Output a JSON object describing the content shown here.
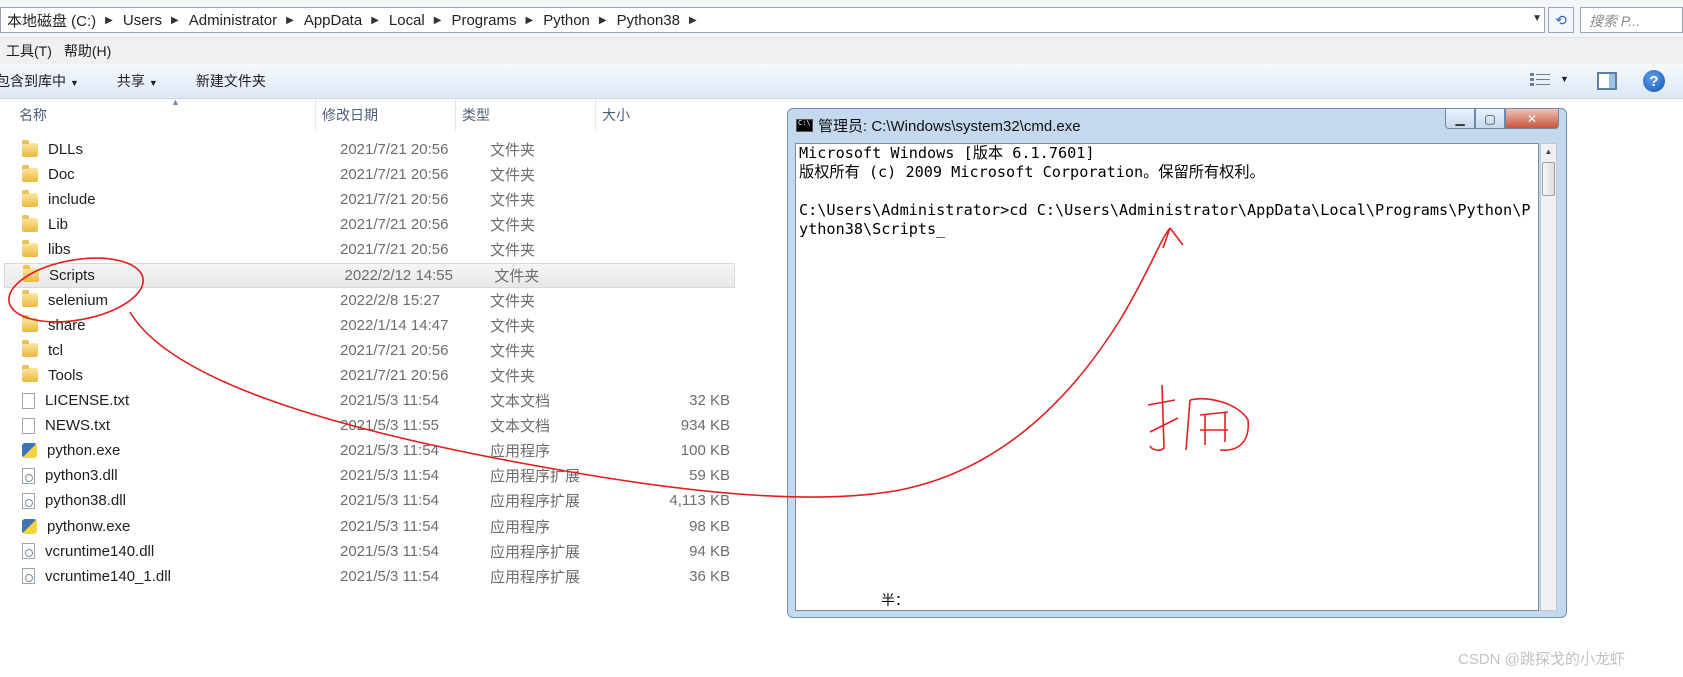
{
  "address": {
    "crumbs": [
      "本地磁盘 (C:)",
      "Users",
      "Administrator",
      "AppData",
      "Local",
      "Programs",
      "Python",
      "Python38"
    ],
    "search_placeholder": "搜索 P..."
  },
  "menu": {
    "items": [
      "工具(T)",
      "帮助(H)"
    ]
  },
  "toolbar": {
    "include_library": "包含到库中",
    "share": "共享",
    "new_folder": "新建文件夹"
  },
  "columns": {
    "name": "名称",
    "modified": "修改日期",
    "type": "类型",
    "size": "大小"
  },
  "files": [
    {
      "name": "DLLs",
      "date": "2021/7/21 20:56",
      "type": "文件夹",
      "size": "",
      "icon": "folder-icon"
    },
    {
      "name": "Doc",
      "date": "2021/7/21 20:56",
      "type": "文件夹",
      "size": "",
      "icon": "folder-icon"
    },
    {
      "name": "include",
      "date": "2021/7/21 20:56",
      "type": "文件夹",
      "size": "",
      "icon": "folder-icon"
    },
    {
      "name": "Lib",
      "date": "2021/7/21 20:56",
      "type": "文件夹",
      "size": "",
      "icon": "folder-icon"
    },
    {
      "name": "libs",
      "date": "2021/7/21 20:56",
      "type": "文件夹",
      "size": "",
      "icon": "folder-icon"
    },
    {
      "name": "Scripts",
      "date": "2022/2/12 14:55",
      "type": "文件夹",
      "size": "",
      "icon": "folder-icon",
      "selected": true
    },
    {
      "name": "selenium",
      "date": "2022/2/8 15:27",
      "type": "文件夹",
      "size": "",
      "icon": "folder-icon"
    },
    {
      "name": "share",
      "date": "2022/1/14 14:47",
      "type": "文件夹",
      "size": "",
      "icon": "folder-icon"
    },
    {
      "name": "tcl",
      "date": "2021/7/21 20:56",
      "type": "文件夹",
      "size": "",
      "icon": "folder-icon"
    },
    {
      "name": "Tools",
      "date": "2021/7/21 20:56",
      "type": "文件夹",
      "size": "",
      "icon": "folder-icon"
    },
    {
      "name": "LICENSE.txt",
      "date": "2021/5/3 11:54",
      "type": "文本文档",
      "size": "32 KB",
      "icon": "text-file-icon"
    },
    {
      "name": "NEWS.txt",
      "date": "2021/5/3 11:55",
      "type": "文本文档",
      "size": "934 KB",
      "icon": "text-file-icon"
    },
    {
      "name": "python.exe",
      "date": "2021/5/3 11:54",
      "type": "应用程序",
      "size": "100 KB",
      "icon": "python-exe-icon"
    },
    {
      "name": "python3.dll",
      "date": "2021/5/3 11:54",
      "type": "应用程序扩展",
      "size": "59 KB",
      "icon": "dll-file-icon"
    },
    {
      "name": "python38.dll",
      "date": "2021/5/3 11:54",
      "type": "应用程序扩展",
      "size": "4,113 KB",
      "icon": "dll-file-icon"
    },
    {
      "name": "pythonw.exe",
      "date": "2021/5/3 11:54",
      "type": "应用程序",
      "size": "98 KB",
      "icon": "python-exe-icon"
    },
    {
      "name": "vcruntime140.dll",
      "date": "2021/5/3 11:54",
      "type": "应用程序扩展",
      "size": "94 KB",
      "icon": "dll-file-icon"
    },
    {
      "name": "vcruntime140_1.dll",
      "date": "2021/5/3 11:54",
      "type": "应用程序扩展",
      "size": "36 KB",
      "icon": "dll-file-icon"
    }
  ],
  "cmd": {
    "title": "管理员: C:\\Windows\\system32\\cmd.exe",
    "lines": [
      "Microsoft Windows [版本 6.1.7601]",
      "版权所有 (c) 2009 Microsoft Corporation。保留所有权利。",
      "",
      "C:\\Users\\Administrator>cd C:\\Users\\Administrator\\AppData\\Local\\Programs\\Python\\P",
      "ython38\\Scripts_"
    ],
    "ime_status": "半："
  },
  "annotation": {
    "handwritten_text": "拖"
  },
  "watermark": "CSDN @跳探戈的小龙虾"
}
